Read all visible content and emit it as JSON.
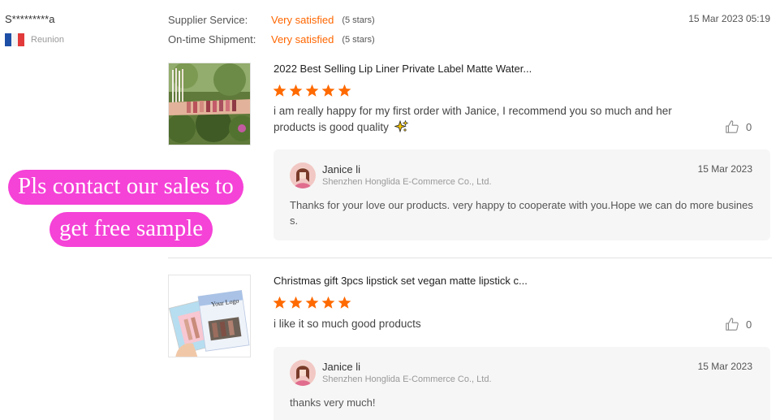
{
  "reviewer": {
    "name": "S*********a",
    "country": "Reunion"
  },
  "ratings": [
    {
      "label": "Supplier Service:",
      "value": "Very satisfied",
      "stars_text": "(5 stars)"
    },
    {
      "label": "On-time Shipment:",
      "value": "Very satisfied",
      "stars_text": "(5 stars)"
    }
  ],
  "review_date": "15 Mar 2023 05:19",
  "colors": {
    "accent": "#ff6600",
    "promo": "#f542d7"
  },
  "reviews": [
    {
      "product_title": "2022 Best Selling Lip Liner Private Label Matte Water...",
      "rating": 5,
      "comment": "i am really happy for my first order with Janice, I recommend you so much and her products is good quality",
      "comment_icon": "sparkles-icon",
      "likes": "0",
      "reply": {
        "name": "Janice li",
        "company": "Shenzhen Honglida E-Commerce Co., Ltd.",
        "date": "15 Mar 2023",
        "text": "Thanks for your love  our products.  very happy to cooperate with you.Hope we can do more business."
      }
    },
    {
      "product_title": "Christmas gift 3pcs lipstick set vegan matte lipstick c...",
      "rating": 5,
      "comment": "i like it so much good products",
      "likes": "0",
      "thumb_logo_text": "Your Logo",
      "reply": {
        "name": "Janice li",
        "company": "Shenzhen Honglida E-Commerce Co., Ltd.",
        "date": "15 Mar 2023",
        "text": "thanks very much!"
      }
    }
  ],
  "promo": {
    "line1": "Pls contact our sales to",
    "line2": "get free sample"
  }
}
